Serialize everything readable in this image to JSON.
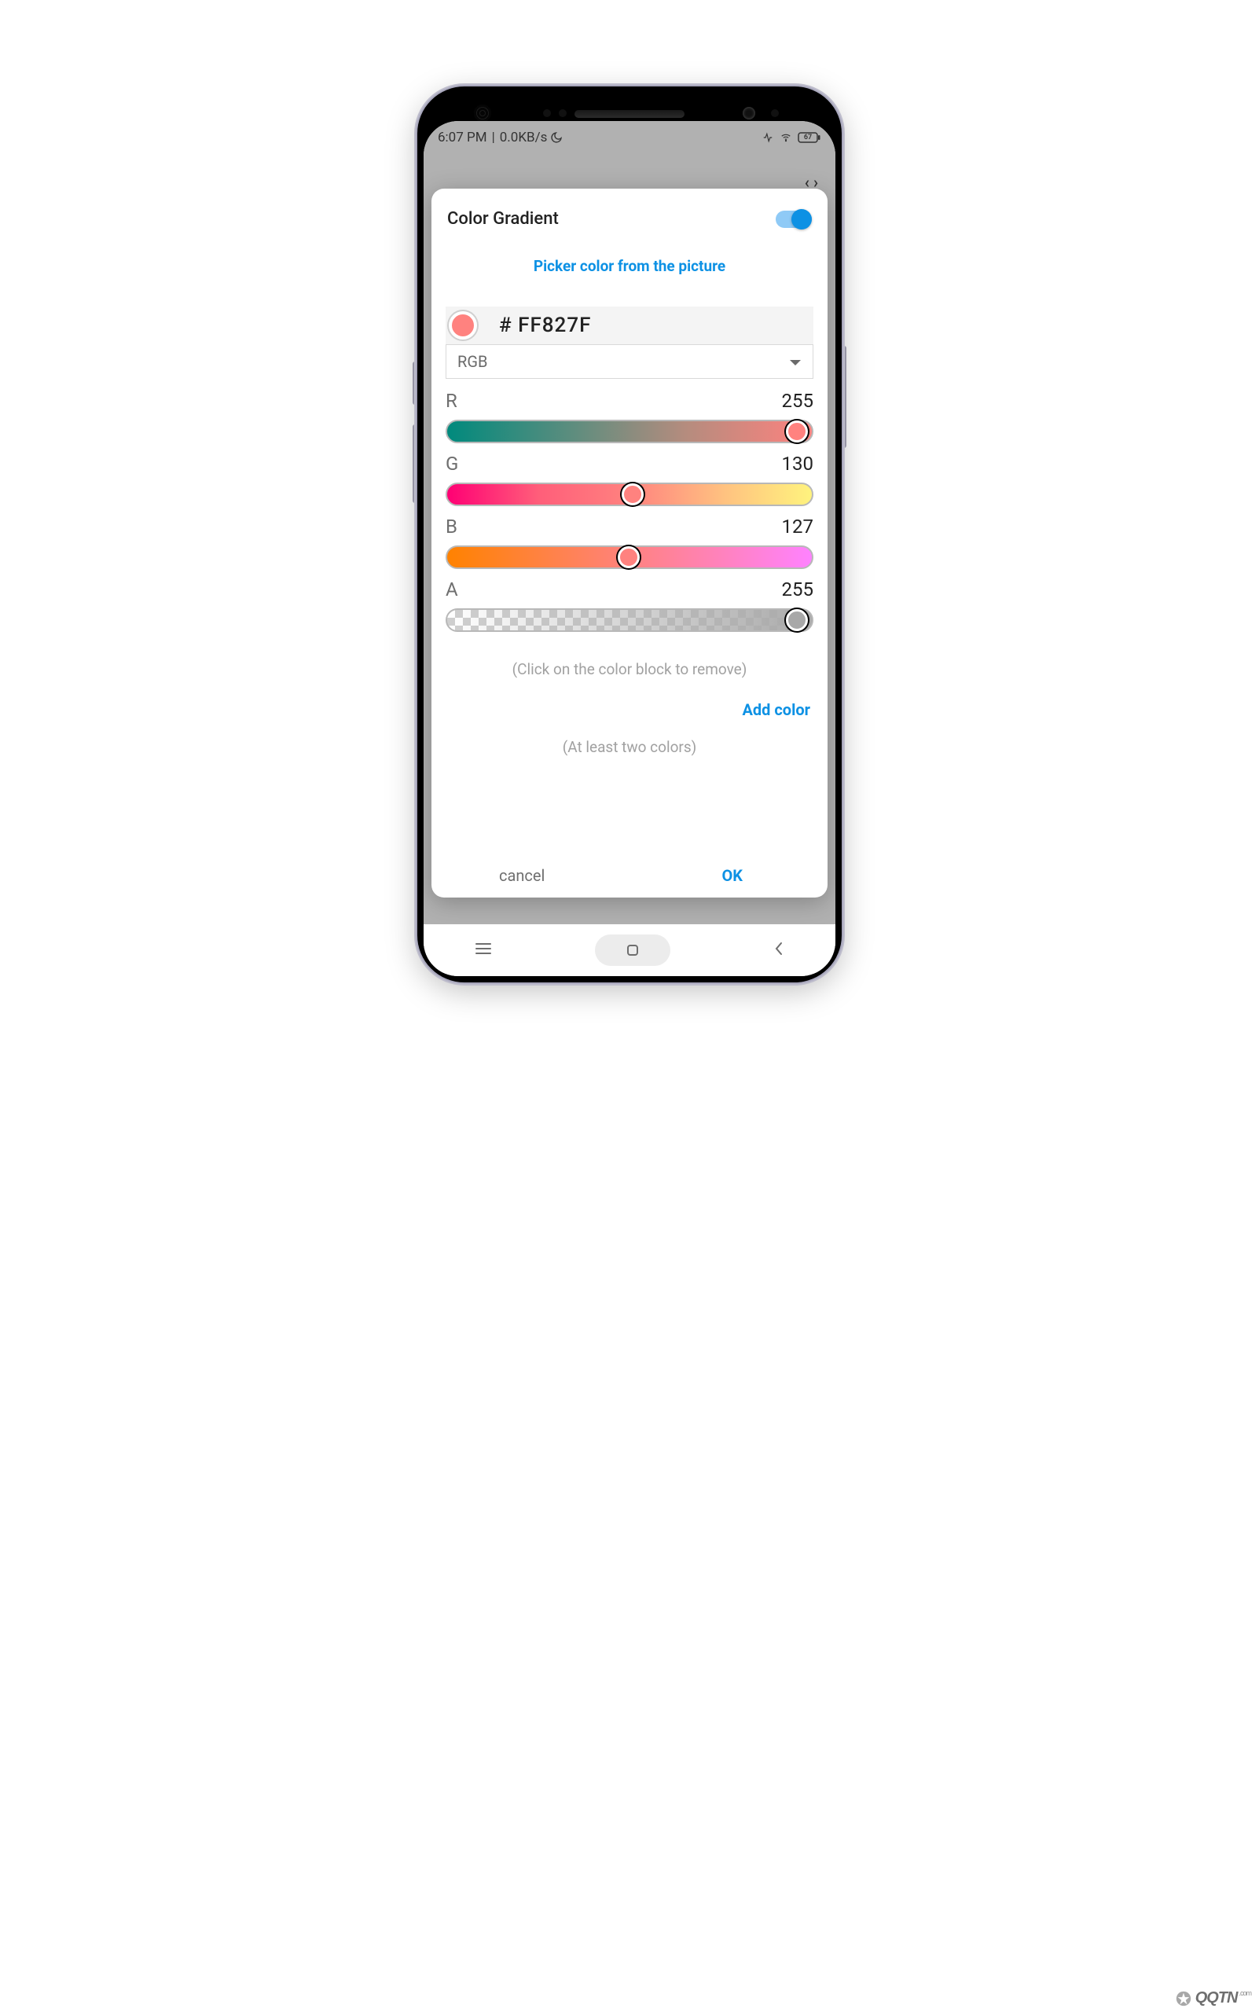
{
  "statusbar": {
    "time": "6:07 PM",
    "speed": "0.0KB/s",
    "battery": "67"
  },
  "bg_header": {
    "code": "‹ ›"
  },
  "modal": {
    "title": "Color Gradient",
    "toggle_on": true,
    "picker_link": "Picker color from the picture",
    "hex": "# FF827F",
    "swatch_color": "#ff827f",
    "mode": "RGB",
    "channels": {
      "r": {
        "label": "R",
        "value": 255,
        "thumb_color": "#ff827f"
      },
      "g": {
        "label": "G",
        "value": 130,
        "thumb_color": "#ff827f"
      },
      "b": {
        "label": "B",
        "value": 127,
        "thumb_color": "#ff827f"
      },
      "a": {
        "label": "A",
        "value": 255,
        "thumb_color": "#a8a8a8"
      }
    },
    "hint_remove": "(Click on the color block to remove)",
    "add_color": "Add color",
    "hint_min": "(At least two colors)",
    "cancel": "cancel",
    "ok": "OK"
  },
  "watermark": "QQTN"
}
